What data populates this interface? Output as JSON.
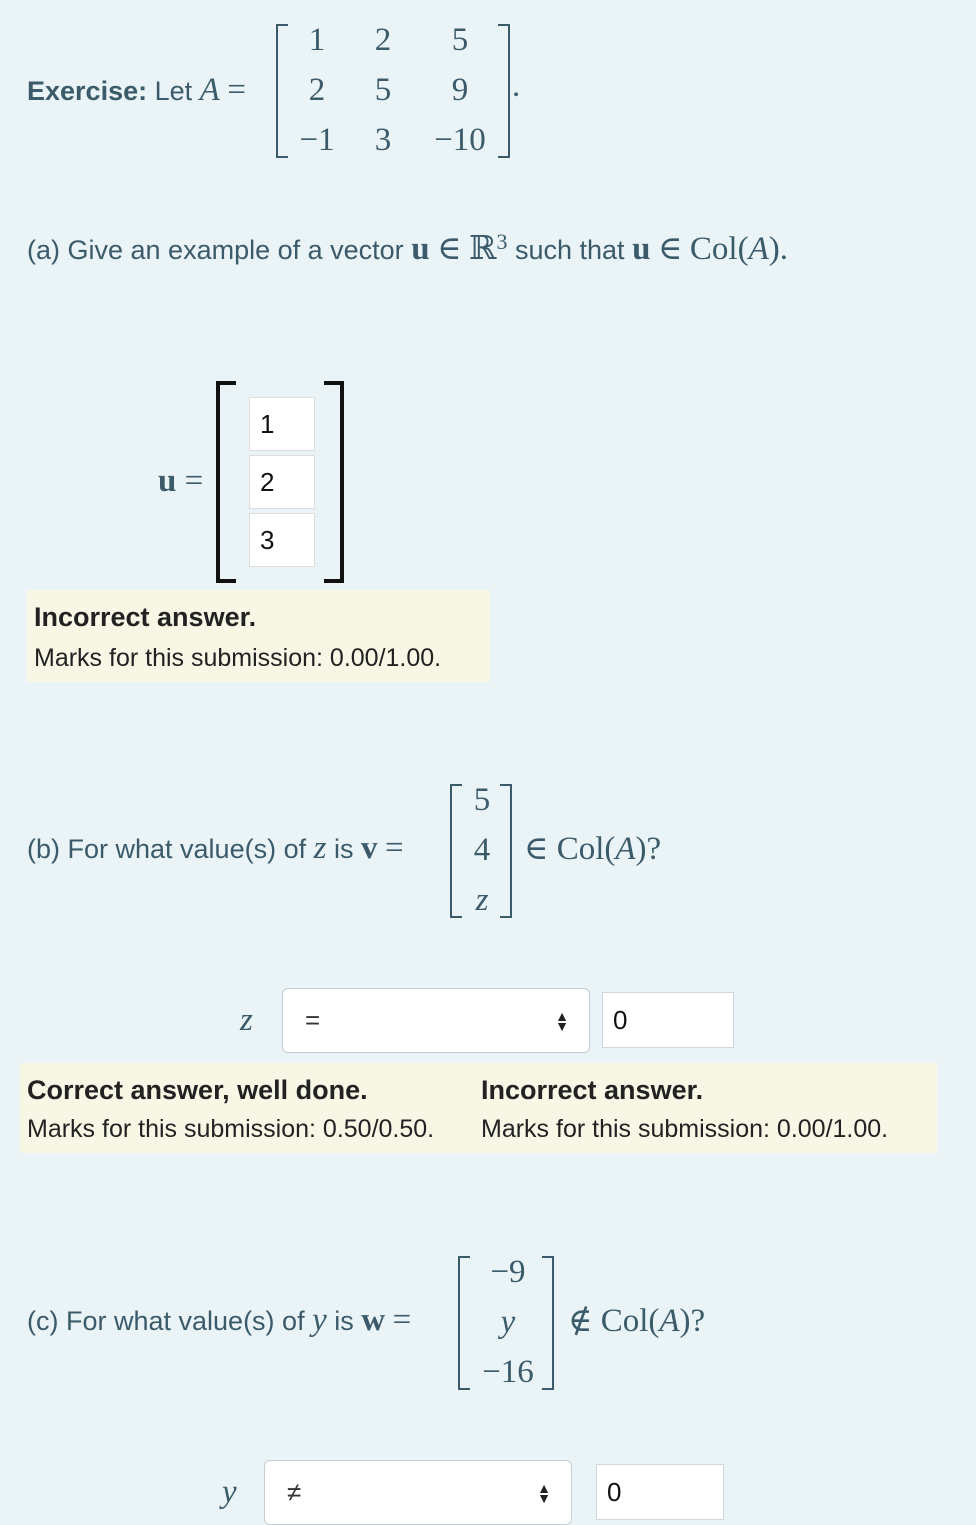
{
  "exercise": {
    "label": "Exercise:",
    "let_text": "Let",
    "matrix_name": "A",
    "equals": "=",
    "matrix": [
      [
        "1",
        "2",
        "5"
      ],
      [
        "2",
        "5",
        "9"
      ],
      [
        "−1",
        "3",
        "−10"
      ]
    ],
    "period": "."
  },
  "part_a": {
    "prefix": "(a) Give an example of a vector",
    "vec": "u",
    "elem": "∈",
    "space": "ℝ",
    "space_exp": "3",
    "middle": "such that",
    "vec2": "u",
    "elem2": "∈",
    "col": "Col(",
    "col_arg": "A",
    "col_close": ").",
    "answer_label": "u",
    "answer_equals": "=",
    "inputs": [
      "1",
      "2",
      "3"
    ],
    "feedback": {
      "title": "Incorrect answer.",
      "marks": "Marks for this submission: 0.00/1.00."
    }
  },
  "part_b": {
    "prefix": "(b) For what value(s) of",
    "var": "z",
    "is": "is",
    "vec": "v",
    "equals": "=",
    "vector": [
      "5",
      "4",
      "z"
    ],
    "suffix_elem": "∈",
    "suffix_col": "Col(",
    "suffix_arg": "A",
    "suffix_close": ")?",
    "answer_var": "z",
    "select_value": "=",
    "input_value": "0",
    "feedback": [
      {
        "title": "Correct answer, well done.",
        "marks": "Marks for this submission: 0.50/0.50."
      },
      {
        "title": "Incorrect answer.",
        "marks": "Marks for this submission: 0.00/1.00."
      }
    ]
  },
  "part_c": {
    "prefix": "(c) For what value(s) of",
    "var": "y",
    "is": "is",
    "vec": "w",
    "equals": "=",
    "vector": [
      "−9",
      "y",
      "−16"
    ],
    "suffix_notelem": "∉",
    "suffix_col": "Col(",
    "suffix_arg": "A",
    "suffix_close": ")?",
    "answer_var": "y",
    "select_value": "≠",
    "input_value": "0"
  },
  "colors": {
    "background": "#eaf4f7",
    "text": "#3b5a6a",
    "feedback_bg": "#f8f7e6"
  }
}
